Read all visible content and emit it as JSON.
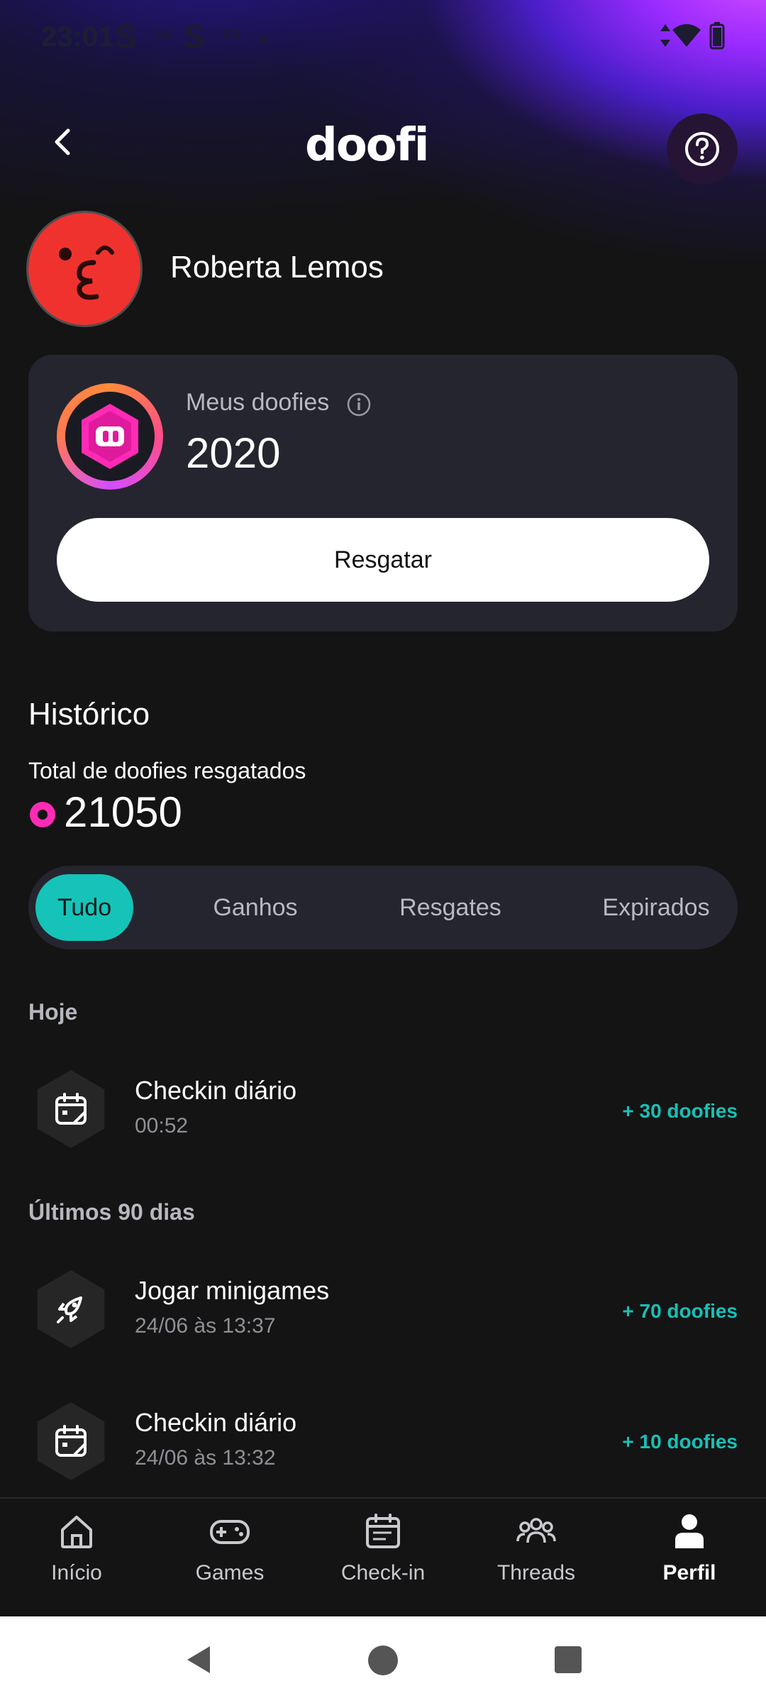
{
  "status_bar": {
    "time": "23:01",
    "icons": [
      "s-app-icon",
      "mini-app-icon",
      "s-app-icon",
      "mini-app-icon",
      "dot-icon",
      "data-arrows-icon",
      "wifi-icon",
      "battery-icon"
    ]
  },
  "header": {
    "logo_text": "doofi",
    "back_icon": "chevron-left-icon",
    "help_icon": "question-circle-icon"
  },
  "profile": {
    "name": "Roberta Lemos",
    "avatar_icon": "kiss-face-avatar"
  },
  "balance_card": {
    "label": "Meus doofies",
    "value": "2020",
    "button_label": "Resgatar"
  },
  "history": {
    "title": "Histórico",
    "total_label": "Total de doofies resgatados",
    "total_value": "21050",
    "tabs": [
      {
        "label": "Tudo",
        "active": true
      },
      {
        "label": "Ganhos",
        "active": false
      },
      {
        "label": "Resgates",
        "active": false
      },
      {
        "label": "Expirados",
        "active": false
      }
    ],
    "sections": [
      {
        "label": "Hoje",
        "items": [
          {
            "icon": "calendar-icon",
            "title": "Checkin diário",
            "subtitle": "00:52",
            "amount": "+ 30 doofies"
          }
        ]
      },
      {
        "label": "Últimos 90 dias",
        "items": [
          {
            "icon": "rocket-icon",
            "title": "Jogar minigames",
            "subtitle": "24/06 às 13:37",
            "amount": "+ 70 doofies"
          },
          {
            "icon": "calendar-icon",
            "title": "Checkin diário",
            "subtitle": "24/06 às 13:32",
            "amount": "+ 10 doofies"
          }
        ]
      }
    ]
  },
  "bottom_nav": [
    {
      "label": "Início",
      "icon": "home-icon"
    },
    {
      "label": "Games",
      "icon": "gamepad-icon"
    },
    {
      "label": "Check-in",
      "icon": "calendar-icon"
    },
    {
      "label": "Threads",
      "icon": "group-icon"
    },
    {
      "label": "Perfil",
      "icon": "user-icon",
      "active": true
    }
  ],
  "colors": {
    "accent_teal": "#16c3b9",
    "background": "#141414",
    "card": "#25252f",
    "coin_pink": "#ff2bb5"
  }
}
